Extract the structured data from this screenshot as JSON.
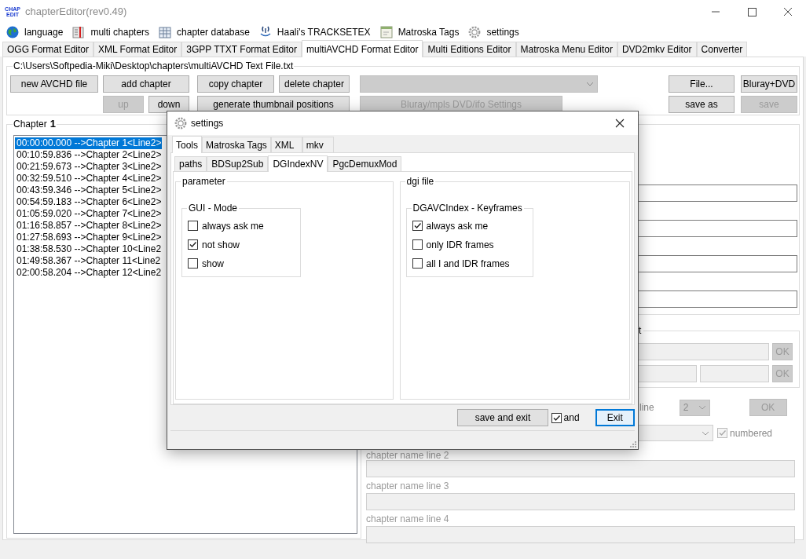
{
  "window": {
    "title": "chapterEditor(rev0.49)",
    "logo_text": [
      "CHAP",
      "EDIT"
    ]
  },
  "menu": [
    {
      "label": "language",
      "kind": "globe"
    },
    {
      "label": "multi chapters",
      "kind": "book"
    },
    {
      "label": "chapter database",
      "kind": "table"
    },
    {
      "label": "Haali's TRACKSETEX",
      "kind": "haali"
    },
    {
      "label": "Matroska Tags",
      "kind": "window"
    },
    {
      "label": "settings",
      "kind": "gear"
    }
  ],
  "tabs": [
    {
      "label": "OGG Format Editor",
      "selected": false
    },
    {
      "label": "XML Format Editor",
      "selected": false
    },
    {
      "label": "3GPP TTXT Format Editor",
      "selected": false
    },
    {
      "label": "multiAVCHD Format Editor",
      "selected": true
    },
    {
      "label": "Multi Editions Editor",
      "selected": false
    },
    {
      "label": "Matroska Menu Editor",
      "selected": false
    },
    {
      "label": "DVD2mkv Editor",
      "selected": false
    },
    {
      "label": "Converter",
      "selected": false
    }
  ],
  "file_group": {
    "title": "C:\\Users\\Softpedia-Miki\\Desktop\\chapters\\multiAVCHD Text File.txt",
    "row_1": [
      {
        "kind": "button",
        "label": "new AVCHD file",
        "disabled": false
      },
      {
        "kind": "button",
        "label": "add chapter",
        "disabled": false
      },
      {
        "kind": "button",
        "label": "copy chapter",
        "disabled": false
      },
      {
        "kind": "button",
        "label": "delete chapter",
        "disabled": false
      },
      {
        "kind": "dropdown",
        "disabled": true
      },
      {
        "kind": "button",
        "label": "File...",
        "disabled": false
      },
      {
        "kind": "button",
        "label": "Bluray+DVD",
        "disabled": false
      }
    ],
    "row_2": [
      {
        "kind": "button",
        "label": "up",
        "disabled": true
      },
      {
        "kind": "button",
        "label": "down",
        "disabled": false
      },
      {
        "kind": "button",
        "label": "generate thumbnail positions",
        "disabled": false
      },
      {
        "kind": "button",
        "label": "Bluray/mpls DVD/ifo Settings",
        "disabled": true
      },
      {
        "kind": "button",
        "label": "save as",
        "disabled": false
      },
      {
        "kind": "button",
        "label": "save",
        "disabled": true
      }
    ]
  },
  "chapter_group": {
    "title": "Chapter",
    "number": "1",
    "items": [
      {
        "text": "00:00:00.000 -->Chapter 1<Line2>",
        "selected": true
      },
      {
        "text": "00:10:59.836 -->Chapter 2<Line2>",
        "selected": false
      },
      {
        "text": "00:21:59.673 -->Chapter 3<Line2>",
        "selected": false
      },
      {
        "text": "00:32:59.510 -->Chapter 4<Line2>",
        "selected": false
      },
      {
        "text": "00:43:59.346 -->Chapter 5<Line2>",
        "selected": false
      },
      {
        "text": "00:54:59.183 -->Chapter 6<Line2>",
        "selected": false
      },
      {
        "text": "01:05:59.020 -->Chapter 7<Line2>",
        "selected": false
      },
      {
        "text": "01:16:58.857 -->Chapter 8<Line2>",
        "selected": false
      },
      {
        "text": "01:27:58.693 -->Chapter 9<Line2>",
        "selected": false
      },
      {
        "text": "01:38:58.530 -->Chapter 10<Line2",
        "selected": false
      },
      {
        "text": "01:49:58.367 -->Chapter 11<Line2",
        "selected": false
      },
      {
        "text": "02:00:58.204 -->Chapter 12<Line2",
        "selected": false
      }
    ]
  },
  "details_fields": [
    {
      "disabled": false
    },
    {
      "disabled": false
    },
    {
      "disabled": false
    },
    {
      "disabled": false
    }
  ],
  "second_group": {
    "title": "t",
    "ok_buttons": [
      {
        "label": "OK",
        "disabled": true
      },
      {
        "label": "OK",
        "disabled": true
      }
    ]
  },
  "line_row": {
    "label": "line",
    "dropdown_value": "2",
    "ok": {
      "label": "OK",
      "disabled": true
    },
    "numbered": {
      "label": "numbered",
      "checked": true,
      "disabled": true
    }
  },
  "name_lines": [
    {
      "label": "chapter name line 2",
      "disabled": true
    },
    {
      "label": "chapter name line 3",
      "disabled": true
    },
    {
      "label": "chapter name line 4",
      "disabled": true
    }
  ],
  "dialog": {
    "title": "settings",
    "tabs": [
      {
        "label": "Tools",
        "selected": true
      },
      {
        "label": "Matroska Tags",
        "selected": false
      },
      {
        "label": "XML",
        "selected": false
      },
      {
        "label": "mkv",
        "selected": false
      }
    ],
    "subtabs": [
      {
        "label": "paths",
        "selected": false
      },
      {
        "label": "BDSup2Sub",
        "selected": false
      },
      {
        "label": "DGIndexNV",
        "selected": true
      },
      {
        "label": "PgcDemuxMod",
        "selected": false
      }
    ],
    "groups": [
      {
        "title": "parameter",
        "inner_title": "GUI - Mode",
        "options": [
          {
            "label": "always ask me",
            "checked": false
          },
          {
            "label": "not show",
            "checked": true
          },
          {
            "label": "show",
            "checked": false
          }
        ]
      },
      {
        "title": "dgi file",
        "inner_title": "DGAVCIndex - Keyframes",
        "options": [
          {
            "label": "always ask me",
            "checked": true
          },
          {
            "label": "only IDR frames",
            "checked": false
          },
          {
            "label": "all I and IDR frames",
            "checked": false
          }
        ]
      }
    ],
    "save_button": "save and exit",
    "and_checkbox": {
      "label": "and",
      "checked": true
    },
    "exit_button": {
      "label": "Exit",
      "focused": true
    }
  }
}
